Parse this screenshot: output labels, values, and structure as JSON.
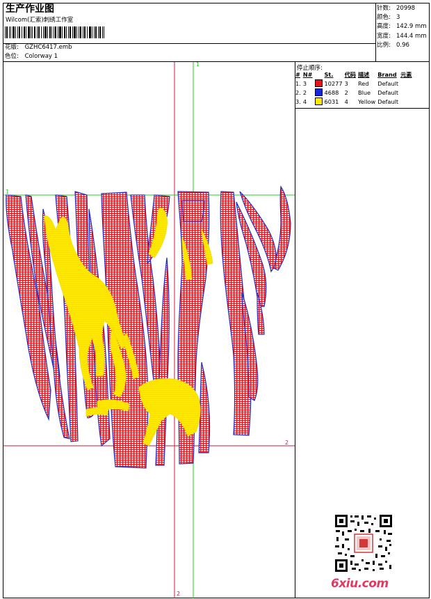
{
  "header": {
    "title": "生产作业图",
    "company": "Wilcom(汇索)刺绣工作室",
    "design_label": "花版:",
    "design_file": "GZHC6417.emb",
    "colorway_label": "色位:",
    "colorway": "Colorway 1"
  },
  "stats": {
    "stitches_label": "针数:",
    "stitches": "20998",
    "colors_label": "颜色:",
    "colors": "3",
    "height_label": "高度:",
    "height": "142.9 mm",
    "width_label": "宽度:",
    "width": "144.4 mm",
    "scale_label": "比例:",
    "scale": "0.96"
  },
  "stop_sequence": {
    "label": "停止顺序:",
    "columns": [
      "#",
      "N#",
      "St.",
      "代码",
      "描述",
      "Brand",
      "元素"
    ],
    "rows": [
      {
        "idx": "1.",
        "needle": "3",
        "color": "#e8141b",
        "stitches": "10277",
        "code": "3",
        "desc": "Red",
        "brand": "Default"
      },
      {
        "idx": "2.",
        "needle": "2",
        "color": "#1428d8",
        "stitches": "4688",
        "code": "2",
        "desc": "Blue",
        "brand": "Default"
      },
      {
        "idx": "3.",
        "needle": "4",
        "color": "#ffea00",
        "stitches": "6031",
        "code": "4",
        "desc": "Yellow",
        "brand": "Default"
      }
    ]
  },
  "guides": {
    "label_1": "1",
    "label_2": "2",
    "green": "#19d319",
    "red": "#d01a3a"
  },
  "watermark": {
    "text": "6xiu.com"
  },
  "colors": {
    "red": "#e8141b",
    "blue": "#2030c8",
    "yellow": "#ffea00"
  }
}
